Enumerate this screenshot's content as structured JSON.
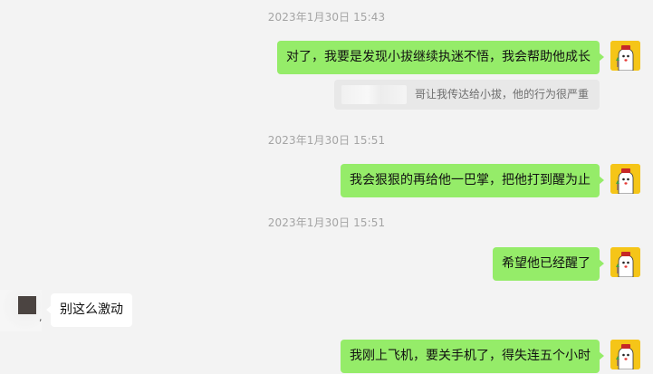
{
  "messages": [
    {
      "type": "timestamp",
      "text": "2023年1月30日 15:43"
    },
    {
      "type": "sent",
      "text": "对了，我要是发现小拔继续执迷不悟，我会帮助他成长",
      "avatar_icon": "cartoon-ghost-avatar-icon"
    },
    {
      "type": "quote",
      "text": "哥让我传达给小拔，他的行为很严重"
    },
    {
      "type": "timestamp",
      "text": "2023年1月30日 15:51"
    },
    {
      "type": "sent",
      "text": "我会狠狠的再给他一巴掌，把他打到醒为止",
      "avatar_icon": "cartoon-ghost-avatar-icon"
    },
    {
      "type": "timestamp",
      "text": "2023年1月30日 15:51"
    },
    {
      "type": "sent",
      "text": "希望他已经醒了",
      "avatar_icon": "cartoon-ghost-avatar-icon"
    },
    {
      "type": "received",
      "text": "别这么激动",
      "sender_mark": ","
    },
    {
      "type": "sent",
      "text": "我刚上飞机，要关手机了，得失连五个小时",
      "avatar_icon": "cartoon-ghost-avatar-icon"
    }
  ],
  "colors": {
    "background": "#f3f3f3",
    "sent_bubble": "#95ec69",
    "received_bubble": "#ffffff",
    "timestamp_text": "#a4a4a4",
    "avatar_bg": "#f5c518"
  }
}
